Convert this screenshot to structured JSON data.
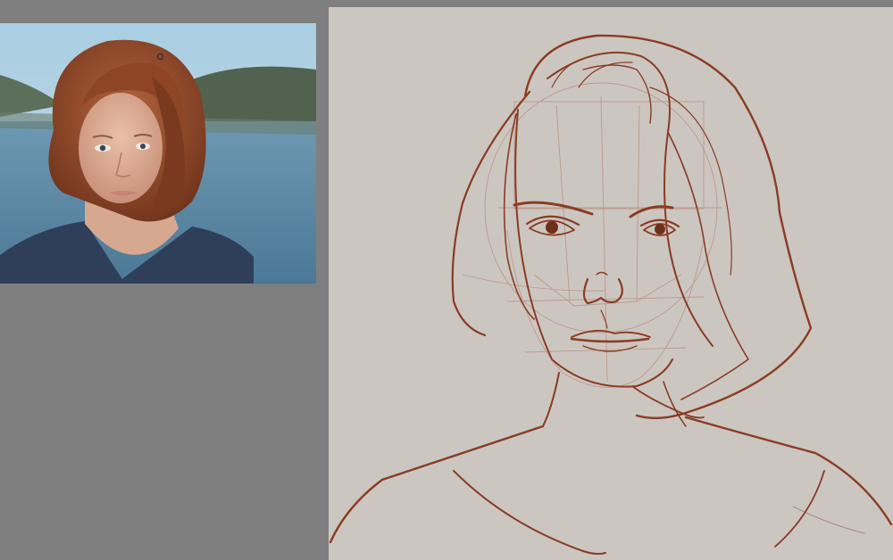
{
  "app": {
    "workspace_background": "#7f7f7f",
    "canvas_background": "#ccc6c1",
    "sketch_stroke_color": "#8a3c22",
    "guide_stroke_color": "#b98a78"
  },
  "reference_image": {
    "subject": "portrait-photo"
  },
  "canvas": {
    "content": "portrait-sketch"
  },
  "cursor": {
    "shape": "brush-circle-icon"
  }
}
